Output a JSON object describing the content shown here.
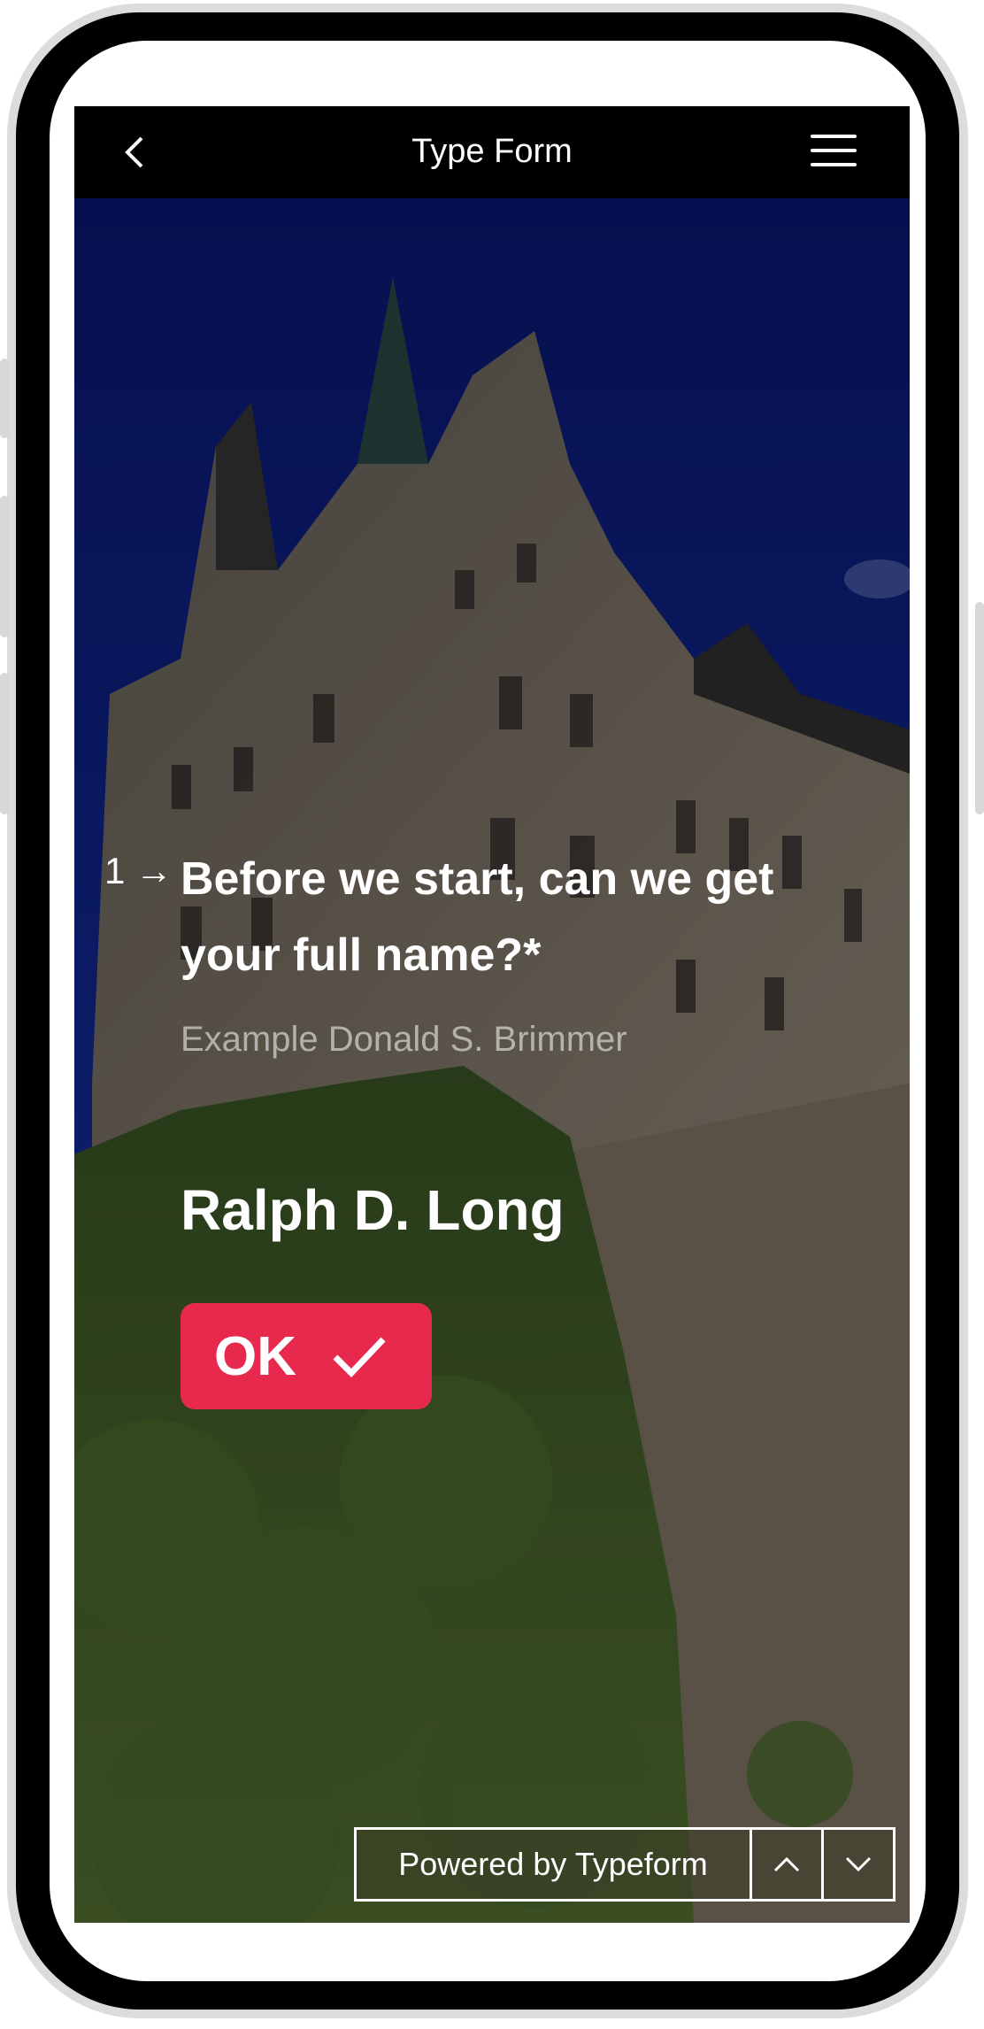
{
  "appbar": {
    "title": "Type Form"
  },
  "question": {
    "number": "1",
    "arrow": "→",
    "text": "Before we start, can we get your full name?*",
    "hint": "Example Donald S. Brimmer",
    "answer": "Ralph D. Long"
  },
  "actions": {
    "ok_label": "OK"
  },
  "footer": {
    "powered_label": "Powered by Typeform"
  },
  "colors": {
    "accent": "#e8294e",
    "appbar": "#000000",
    "sky": "#0b1e78"
  }
}
